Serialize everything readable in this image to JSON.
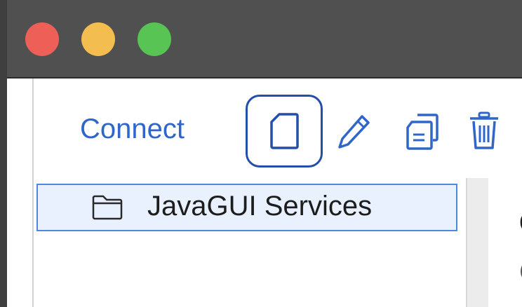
{
  "window": {
    "controls": [
      "close",
      "minimize",
      "maximize"
    ],
    "colors": {
      "close": "#ee5f57",
      "minimize": "#f4bd4f",
      "maximize": "#58c454",
      "titlebar": "#505050"
    }
  },
  "toolbar": {
    "connect_label": "Connect",
    "buttons": [
      {
        "name": "new",
        "icon": "new-document-icon",
        "selected": true
      },
      {
        "name": "edit",
        "icon": "pencil-icon"
      },
      {
        "name": "duplicate",
        "icon": "copy-icon"
      },
      {
        "name": "delete",
        "icon": "trash-icon"
      }
    ],
    "accent_color": "#2f66c8"
  },
  "tree": {
    "items": [
      {
        "label": "JavaGUI Services",
        "icon": "folder-icon",
        "selected": true
      }
    ],
    "selection_color": "#e8f1fd",
    "selection_border": "#4c88e0"
  },
  "detail": {
    "heading_partial": "C",
    "subtext_partial": "C"
  }
}
